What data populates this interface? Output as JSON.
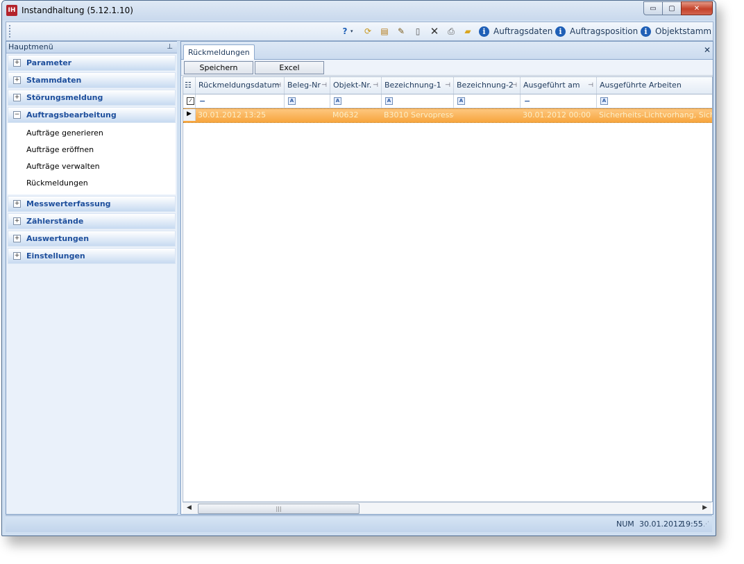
{
  "window": {
    "app_icon_text": "IH",
    "title": "Instandhaltung (5.12.1.10)",
    "minimize": "▭",
    "maximize": "▢",
    "close": "✕"
  },
  "toolbar": {
    "items": [
      "Auftragsdaten",
      "Auftragsposition",
      "Objektstamm"
    ],
    "icons": [
      "help-icon",
      "refresh-icon",
      "edit-properties-icon",
      "edit-icon",
      "new-document-icon",
      "delete-icon",
      "print-icon",
      "open-folder-icon"
    ]
  },
  "left_panel": {
    "header": "Hauptmenü",
    "groups": [
      {
        "label": "Parameter",
        "expanded": false
      },
      {
        "label": "Stammdaten",
        "expanded": false
      },
      {
        "label": "Störungsmeldung",
        "expanded": false
      },
      {
        "label": "Auftragsbearbeitung",
        "expanded": true,
        "items": [
          "Aufträge generieren",
          "Aufträge eröffnen",
          "Aufträge verwalten",
          "Rückmeldungen"
        ]
      },
      {
        "label": "Messwerterfassung",
        "expanded": false
      },
      {
        "label": "Zählerstände",
        "expanded": false
      },
      {
        "label": "Auswertungen",
        "expanded": false
      },
      {
        "label": "Einstellungen",
        "expanded": false
      }
    ]
  },
  "tab": {
    "label": "Rückmeldungen",
    "close": "✕"
  },
  "actions": {
    "save": "Speichern",
    "excel": "Excel"
  },
  "grid": {
    "columns": [
      "Rückmeldungsdatum",
      "Beleg-Nr",
      "Objekt-Nr.",
      "Bezeichnung-1",
      "Bezeichnung-2",
      "Ausgeführt am",
      "Ausgeführte Arbeiten"
    ],
    "filter_types": [
      "dash",
      "A",
      "A",
      "A",
      "A",
      "dash",
      "A"
    ],
    "rows": [
      [
        "30.01.2012 13:25",
        "",
        "M0632",
        "B3010 Servopresse",
        "",
        "30.01.2012 00:00",
        "Sicherheits-Lichtvorhang, Sichern"
      ]
    ]
  },
  "status": {
    "mode": "NUM",
    "date": "30.01.2012",
    "time": "19:55"
  }
}
